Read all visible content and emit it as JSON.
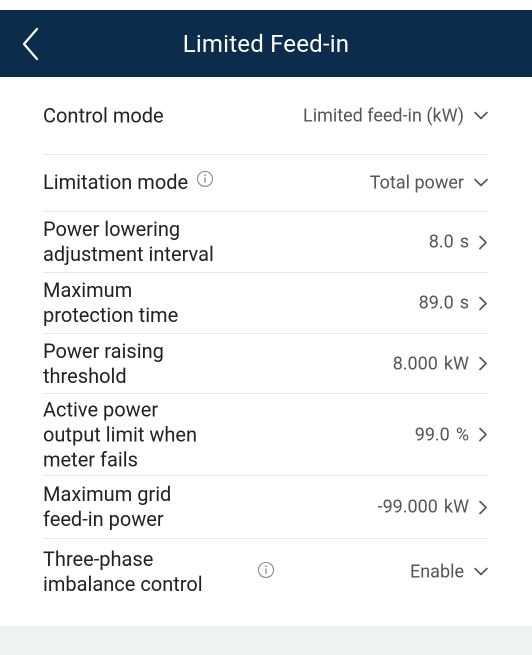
{
  "header": {
    "title": "Limited Feed-in"
  },
  "rows": [
    {
      "label": "Control mode",
      "value": "Limited feed-in (kW)",
      "unit": "",
      "control": "chevron-down"
    },
    {
      "label": "Limitation mode",
      "value": "Total power",
      "unit": "",
      "control": "chevron-down",
      "info": true
    },
    {
      "label": "Power lowering\nadjustment interval",
      "value": "8.0",
      "unit": "s",
      "control": "chevron-right"
    },
    {
      "label": "Maximum\nprotection time",
      "value": "89.0",
      "unit": "s",
      "control": "chevron-right"
    },
    {
      "label": "Power raising\nthreshold",
      "value": "8.000",
      "unit": "kW",
      "control": "chevron-right"
    },
    {
      "label": "Active power\noutput limit when\nmeter fails",
      "value": "99.0",
      "unit": "%",
      "control": "chevron-right"
    },
    {
      "label": "Maximum grid\nfeed-in power",
      "value": "-99.000",
      "unit": "kW",
      "control": "chevron-right"
    },
    {
      "label": "Three-phase\nimbalance control",
      "value": "Enable",
      "unit": "",
      "control": "chevron-down",
      "info": true
    }
  ],
  "colors": {
    "header_bg": "#0b2c4b",
    "header_text": "#ffffff",
    "divider": "#e8e8e8",
    "footer_band": "#eef3f2"
  }
}
